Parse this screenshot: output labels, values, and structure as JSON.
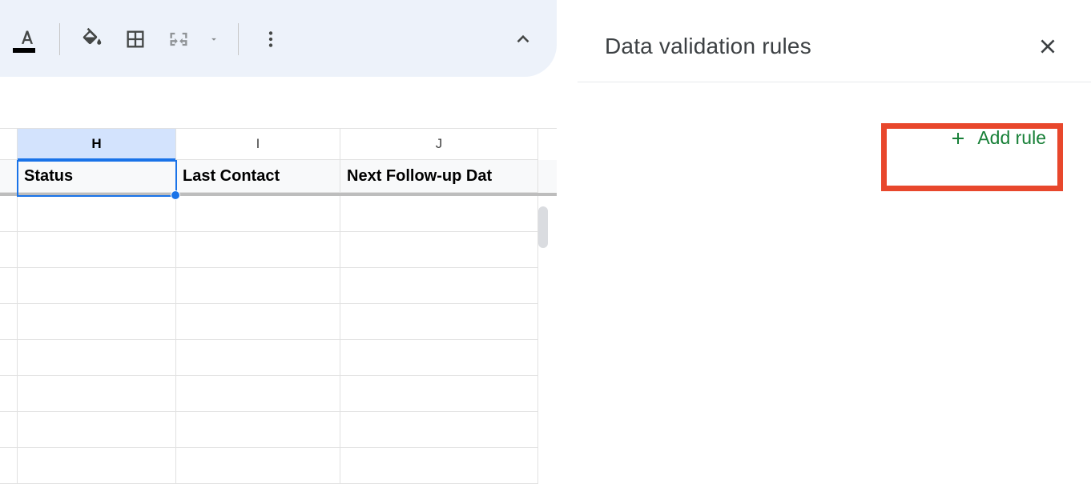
{
  "toolbar": {},
  "columns": {
    "H": "H",
    "I": "I",
    "J": "J"
  },
  "headers": {
    "H": "Status",
    "I": "Last Contact",
    "J": "Next Follow-up Dat"
  },
  "panel": {
    "title": "Data validation rules",
    "add_rule_label": "Add rule"
  }
}
